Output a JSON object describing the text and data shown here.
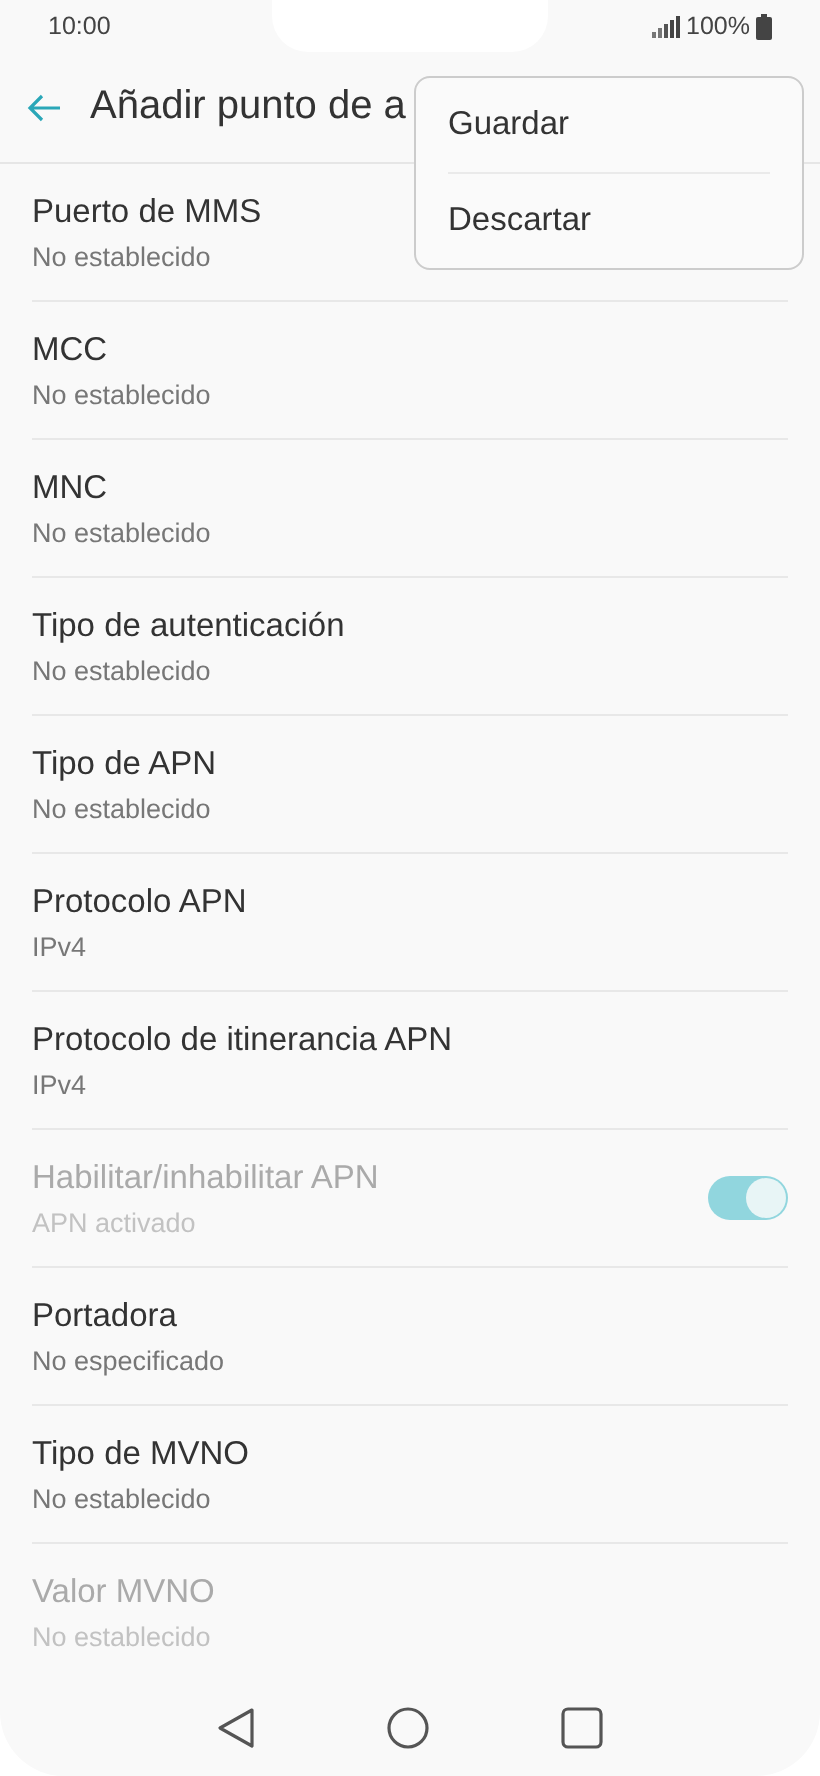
{
  "status_bar": {
    "time": "10:00",
    "battery": "100%"
  },
  "header": {
    "title": "Añadir punto de a"
  },
  "settings": [
    {
      "kind": "text",
      "title": "Puerto de MMS",
      "value": "No establecido",
      "disabled": false
    },
    {
      "kind": "text",
      "title": "MCC",
      "value": "No establecido",
      "disabled": false
    },
    {
      "kind": "text",
      "title": "MNC",
      "value": "No establecido",
      "disabled": false
    },
    {
      "kind": "text",
      "title": "Tipo de autenticación",
      "value": "No establecido",
      "disabled": false
    },
    {
      "kind": "text",
      "title": "Tipo de APN",
      "value": "No establecido",
      "disabled": false
    },
    {
      "kind": "text",
      "title": "Protocolo APN",
      "value": "IPv4",
      "disabled": false
    },
    {
      "kind": "text",
      "title": "Protocolo de itinerancia APN",
      "value": "IPv4",
      "disabled": false
    },
    {
      "kind": "toggle",
      "title": "Habilitar/inhabilitar APN",
      "value": "APN activado",
      "disabled": true,
      "on": true
    },
    {
      "kind": "text",
      "title": "Portadora",
      "value": "No especificado",
      "disabled": false
    },
    {
      "kind": "text",
      "title": "Tipo de MVNO",
      "value": "No establecido",
      "disabled": false
    },
    {
      "kind": "text",
      "title": "Valor MVNO",
      "value": "No establecido",
      "disabled": true
    }
  ],
  "menu": {
    "items": [
      "Guardar",
      "Descartar"
    ]
  }
}
